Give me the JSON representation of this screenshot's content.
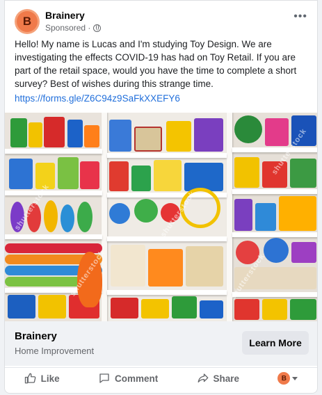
{
  "post": {
    "page_name": "Brainery",
    "sponsored_label": "Sponsored ·",
    "more_label": "•••",
    "body": "Hello! My name is Lucas and I'm studying Toy Design. We are investigating the effects COVID-19 has had on Toy Retail. If you are part of the retail space, would you have the time to complete a short survey? Best of wishes during this strange time.",
    "link": "https://forms.gle/Z6C94z9SaFkXXEFY6",
    "avatar_letter": "B"
  },
  "media": {
    "watermark": "shutterstock"
  },
  "footer": {
    "name": "Brainery",
    "category": "Home Improvement",
    "cta": "Learn More"
  },
  "actions": {
    "like": "Like",
    "comment": "Comment",
    "share": "Share",
    "avatar_letter": "B"
  },
  "colors": {
    "link": "#216fdb",
    "avatar": "#f07a4a",
    "cta_bg": "#e4e6eb"
  }
}
